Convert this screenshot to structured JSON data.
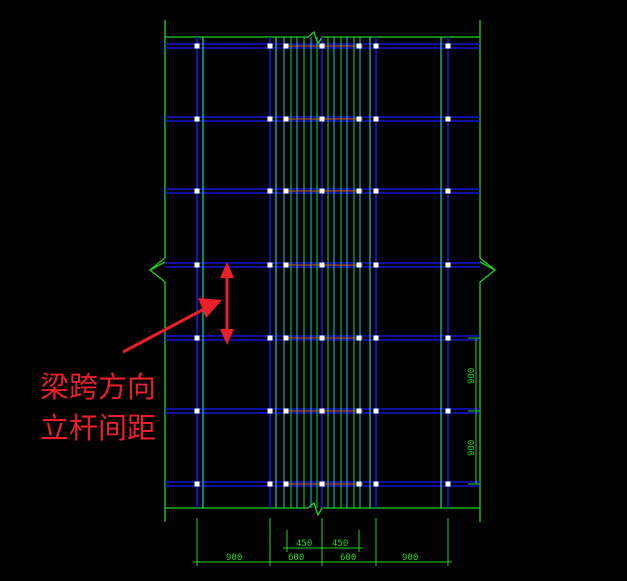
{
  "annotation": {
    "line1": "梁跨方向",
    "line2": "立杆间距",
    "color": "#e8202a"
  },
  "dimensions": {
    "bottom": [
      "900",
      "600",
      "600",
      "900"
    ],
    "bottom_inner": [
      "450",
      "450"
    ],
    "right": [
      "900",
      "900"
    ]
  },
  "colors": {
    "background": "#000000",
    "outline": "#21d421",
    "ledger": "#1a1aff",
    "post": "#19c8c8",
    "beam_accent": "#ff4a4a",
    "dimension": "#1fd61f"
  }
}
